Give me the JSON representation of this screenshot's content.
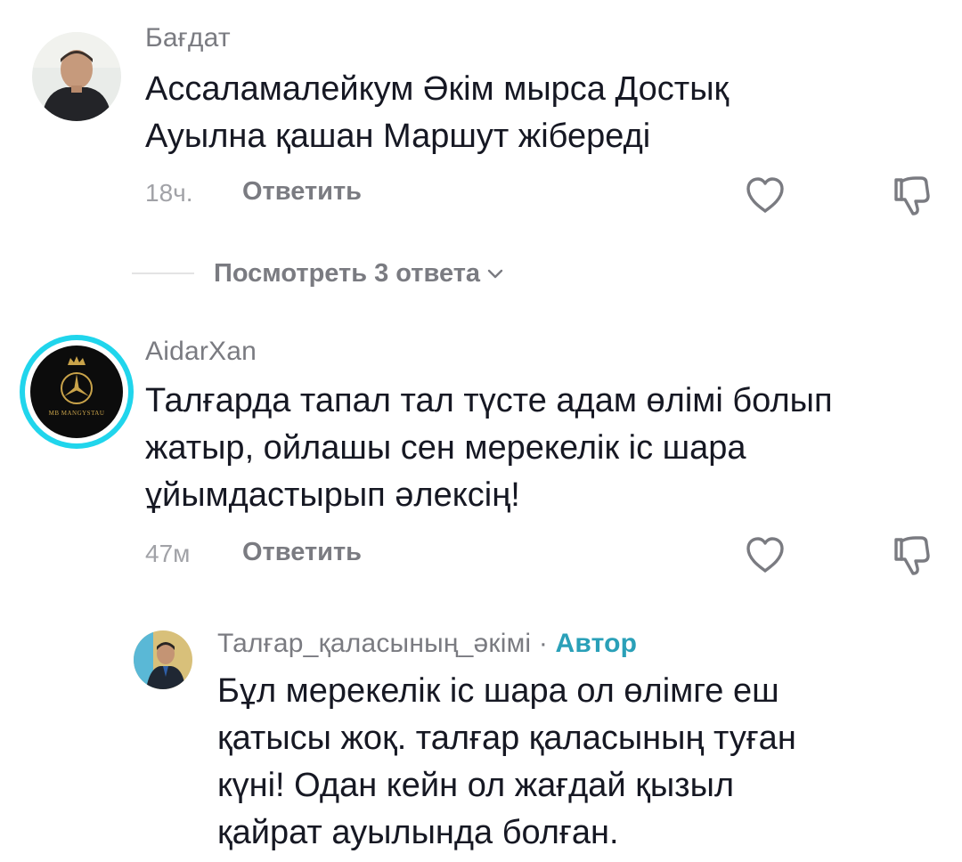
{
  "comments": [
    {
      "username": "Бағдат",
      "text_lines": [
        "Ассаламалейкум Әкім мырса Достық",
        "Ауылна қашан Маршут жібереді"
      ],
      "time": "18ч.",
      "reply_label": "Ответить"
    },
    {
      "username": "AidarXan",
      "text_lines": [
        "Талғарда тапал тал түсте адам өлімі болып",
        "жатыр, ойлашы сен мерекелік іс шара",
        "ұйымдастырып әлексің!"
      ],
      "time": "47м",
      "reply_label": "Ответить",
      "avatar_text": "MB MANGYSTAU"
    }
  ],
  "view_replies_label": "Посмотреть 3 ответа",
  "reply": {
    "username": "Талғар_қаласының_әкімі",
    "separator": " · ",
    "author_badge": "Автор",
    "text_lines": [
      "Бұл мерекелік іс шара ол өлімге еш",
      "қатысы жоқ. талғар қаласының туған",
      "күні! Одан кейн ол жағдай қызыл",
      "қайрат ауылында болған."
    ]
  },
  "icons": {
    "like": "heart-outline-icon",
    "dislike": "thumbs-down-icon",
    "chevron": "chevron-down-icon"
  },
  "colors": {
    "primary_text": "#161823",
    "secondary_text": "#7a7b81",
    "time_text": "#a1a2a7",
    "author_badge": "#2aa0b8",
    "story_ring": "#20d5ec"
  }
}
